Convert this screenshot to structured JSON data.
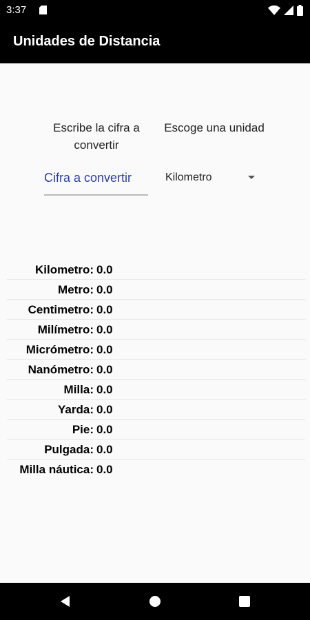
{
  "status_bar": {
    "time": "3:37"
  },
  "app_bar": {
    "title": "Unidades de Distancia"
  },
  "prompts": {
    "enter_amount": "Escribe la cifra a convertir",
    "choose_unit": "Escoge una unidad"
  },
  "amount_input": {
    "value": "",
    "placeholder": "Cifra a convertir"
  },
  "unit_spinner": {
    "selected": "Kilometro"
  },
  "results": [
    {
      "label": "Kilometro:",
      "value": "0.0"
    },
    {
      "label": "Metro:",
      "value": "0.0"
    },
    {
      "label": "Centimetro:",
      "value": "0.0"
    },
    {
      "label": "Milímetro:",
      "value": "0.0"
    },
    {
      "label": "Micrómetro:",
      "value": "0.0"
    },
    {
      "label": "Nanómetro:",
      "value": "0.0"
    },
    {
      "label": "Milla:",
      "value": "0.0"
    },
    {
      "label": "Yarda:",
      "value": "0.0"
    },
    {
      "label": "Pie:",
      "value": "0.0"
    },
    {
      "label": "Pulgada:",
      "value": "0.0"
    },
    {
      "label": "Milla náutica:",
      "value": "0.0"
    }
  ],
  "icons": {
    "status": [
      "sd-card-icon",
      "wifi-icon",
      "cell-signal-icon",
      "battery-icon"
    ],
    "nav": [
      "back-icon",
      "home-icon",
      "recents-icon"
    ]
  },
  "colors": {
    "app_bar": "#000000",
    "accent_text": "#2a3ea8",
    "background": "#fafafa"
  }
}
